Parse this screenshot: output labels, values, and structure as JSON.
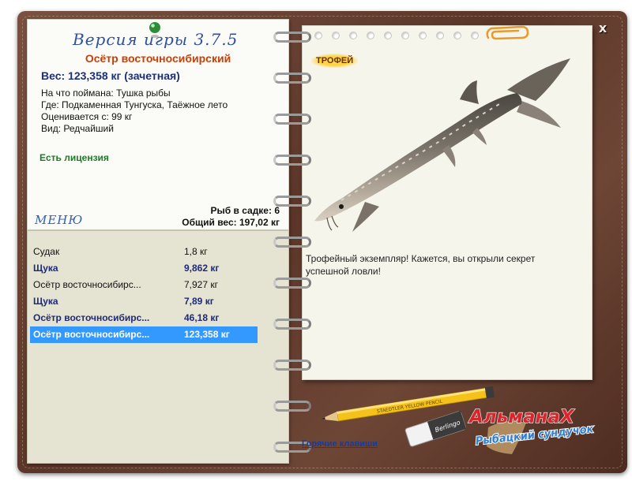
{
  "window": {
    "close_label": "x"
  },
  "left_panel": {
    "version": "Версия игры 3.7.5",
    "fish_name": "Осётр восточносибирский",
    "weight_line": "Вес: 123,358 кг (зачетная)",
    "info": [
      "На что поймана: Тушка рыбы",
      "Где: Подкаменная Тунгуска, Таёжное лето",
      "Оценивается с: 99 кг",
      "Вид: Редчайший"
    ],
    "license": "Есть лицензия",
    "menu_label": "МЕНЮ",
    "fish_in_keepnet": "Рыб в садке: 6",
    "total_weight": "Общий вес: 197,02 кг"
  },
  "catch_list": [
    {
      "name": "Судак",
      "weight": "1,8 кг",
      "style": "normal"
    },
    {
      "name": "Щука",
      "weight": "9,862 кг",
      "style": "bold"
    },
    {
      "name": "Осётр восточносибирс...",
      "weight": "7,927 кг",
      "style": "normal"
    },
    {
      "name": "Щука",
      "weight": "7,89 кг",
      "style": "bold"
    },
    {
      "name": "Осётр восточносибирс...",
      "weight": "46,18 кг",
      "style": "bold"
    },
    {
      "name": "Осётр восточносибирс...",
      "weight": "123,358 кг",
      "style": "selected"
    }
  ],
  "right_panel": {
    "trophy_label": "ТРОФЕЙ",
    "description": "Трофейный экземпляр! Кажется, вы открыли секрет успешной ловли!",
    "hotkeys_label": "Горячие клавиши",
    "logo_title": "АльманаХ",
    "logo_subtitle": "Рыбацкий сундучок",
    "pencil_text": "STAEDTLER YELLOW PENCIL",
    "eraser_text": "Berlingo"
  },
  "colors": {
    "leather": "#5b3628",
    "title_orange": "#c2410c",
    "weight_navy": "#1e2f7a",
    "license_green": "#1e7a2a",
    "selection_blue": "#3399ff",
    "version_blue": "#2f4f9f"
  }
}
